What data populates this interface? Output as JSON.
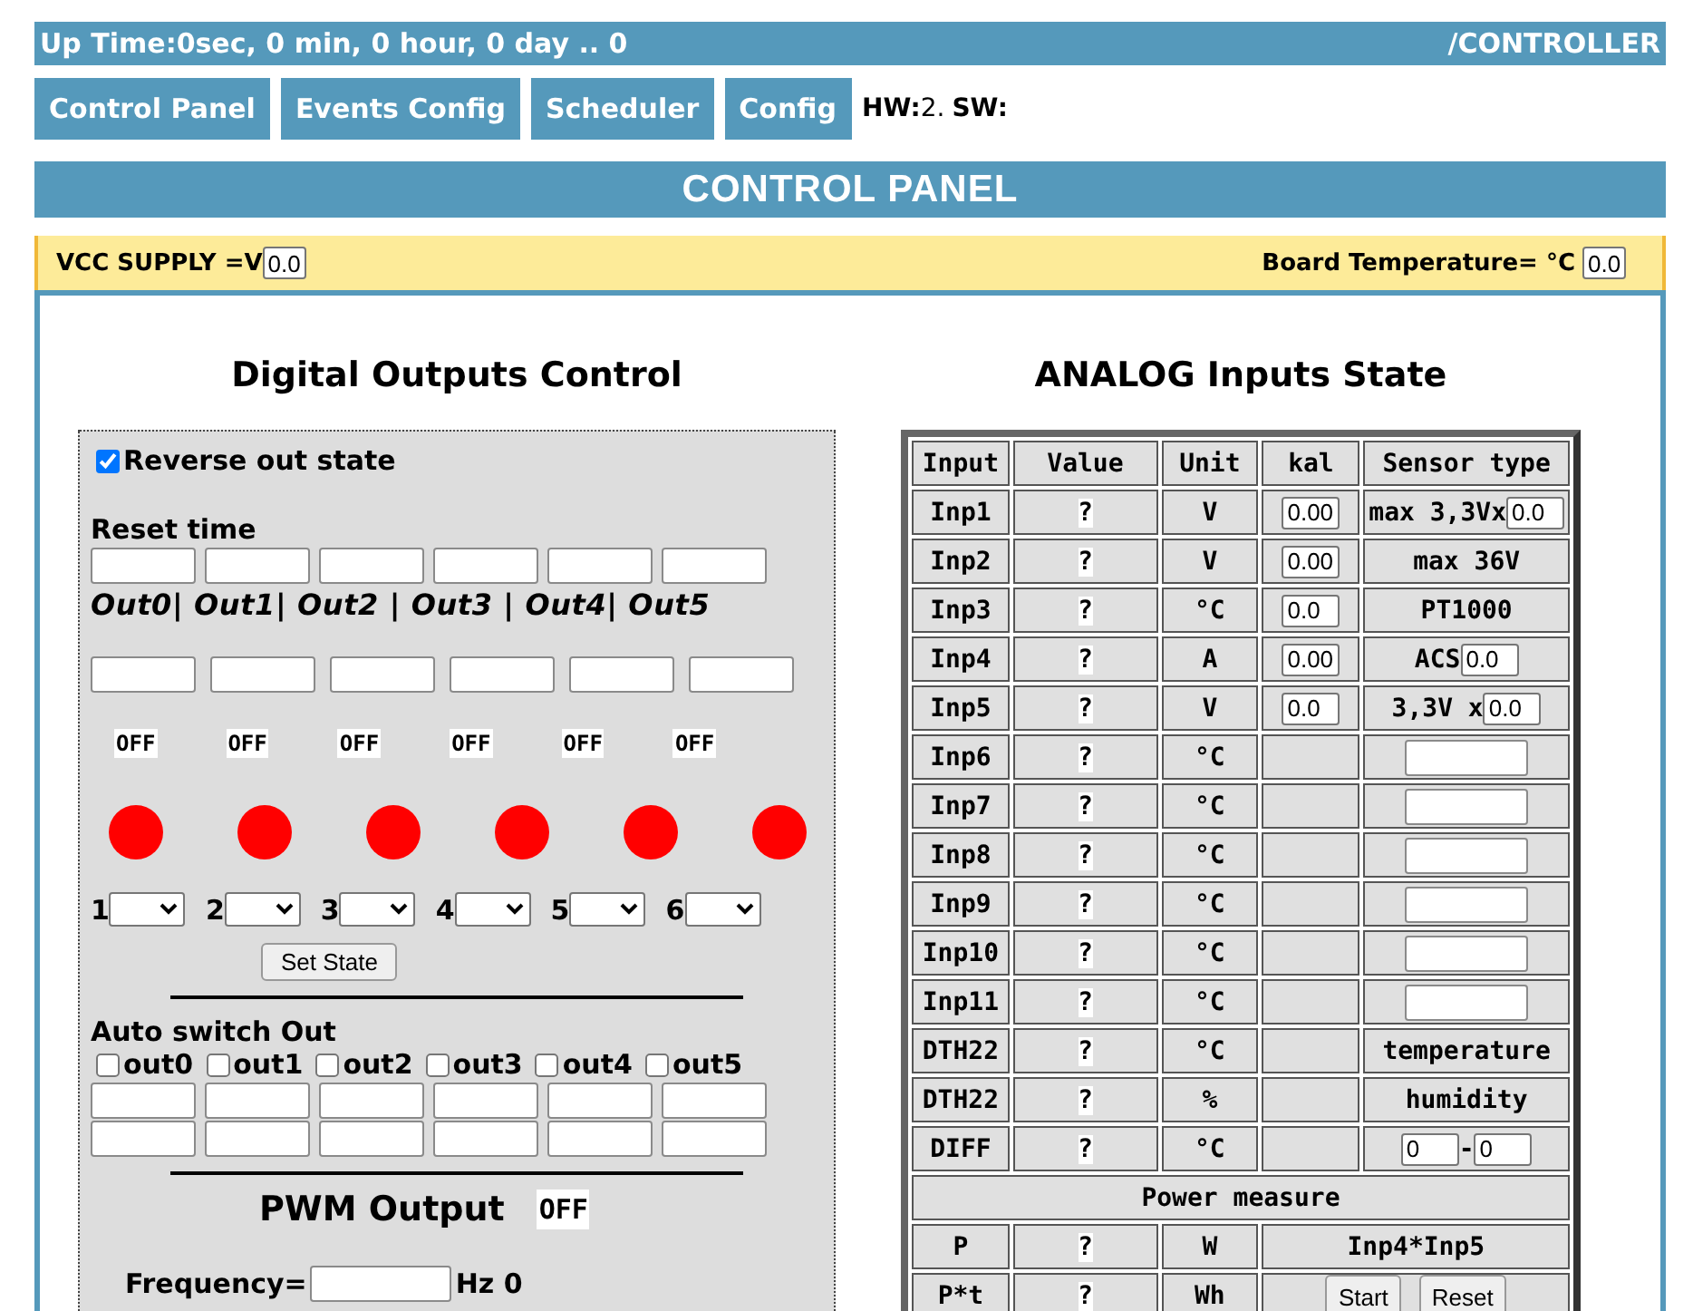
{
  "header": {
    "uptime": "Up Time:0sec, 0 min, 0 hour, 0 day .. 0",
    "path": "/CONTROLLER"
  },
  "nav": {
    "buttons": [
      "Control Panel",
      "Events Config",
      "Scheduler",
      "Config"
    ],
    "hw_label": "HW:",
    "hw_value": "2.",
    "sw_label": "SW:"
  },
  "title": "CONTROL PANEL",
  "supply": {
    "vcc_label": "VCC SUPPLY =V",
    "vcc_value": "0.0",
    "temp_label": "Board Temperature= °C",
    "temp_value": "0.0"
  },
  "digital": {
    "title": "Digital Outputs Control",
    "reverse": {
      "label": "Reverse out state",
      "checked": true
    },
    "reset_label": "Reset time",
    "out_labels": "Out0| Out1| Out2 | Out3 | Out4| Out5",
    "outputs": [
      {
        "state": "OFF",
        "on": false,
        "select_label": "1"
      },
      {
        "state": "OFF",
        "on": false,
        "select_label": "2"
      },
      {
        "state": "OFF",
        "on": false,
        "select_label": "3"
      },
      {
        "state": "OFF",
        "on": false,
        "select_label": "4"
      },
      {
        "state": "OFF",
        "on": false,
        "select_label": "5"
      },
      {
        "state": "OFF",
        "on": false,
        "select_label": "6"
      }
    ],
    "set_state": "Set State",
    "auto_label": "Auto switch Out",
    "auto": [
      {
        "label": "out0",
        "checked": false
      },
      {
        "label": "out1",
        "checked": false
      },
      {
        "label": "out2",
        "checked": false
      },
      {
        "label": "out3",
        "checked": false
      },
      {
        "label": "out4",
        "checked": false
      },
      {
        "label": "out5",
        "checked": false
      }
    ],
    "pwm": {
      "title": "PWM Output",
      "state": "OFF",
      "frequency_label": "Frequency=",
      "frequency_unit": "Hz 0"
    }
  },
  "analog": {
    "title": "ANALOG Inputs State",
    "columns": [
      "Input",
      "Value",
      "Unit",
      "kal",
      "Sensor type"
    ],
    "rows": [
      {
        "input": "Inp1",
        "value": "?",
        "unit": "V",
        "kal": "0.00",
        "sensor": {
          "kind": "text_input",
          "text": "max 3,3Vx",
          "value": "0.0"
        }
      },
      {
        "input": "Inp2",
        "value": "?",
        "unit": "V",
        "kal": "0.00",
        "sensor": {
          "kind": "text",
          "text": "max 36V"
        }
      },
      {
        "input": "Inp3",
        "value": "?",
        "unit": "°C",
        "kal": "0.0",
        "sensor": {
          "kind": "text",
          "text": "PT1000"
        }
      },
      {
        "input": "Inp4",
        "value": "?",
        "unit": "A",
        "kal": "0.00",
        "sensor": {
          "kind": "text_input",
          "text": "ACS",
          "value": "0.0"
        }
      },
      {
        "input": "Inp5",
        "value": "?",
        "unit": "V",
        "kal": "0.0",
        "sensor": {
          "kind": "text_input",
          "text": "3,3V x",
          "value": "0.0"
        }
      },
      {
        "input": "Inp6",
        "value": "?",
        "unit": "°C",
        "sensor": {
          "kind": "input"
        }
      },
      {
        "input": "Inp7",
        "value": "?",
        "unit": "°C",
        "sensor": {
          "kind": "input"
        }
      },
      {
        "input": "Inp8",
        "value": "?",
        "unit": "°C",
        "sensor": {
          "kind": "input"
        }
      },
      {
        "input": "Inp9",
        "value": "?",
        "unit": "°C",
        "sensor": {
          "kind": "input"
        }
      },
      {
        "input": "Inp10",
        "value": "?",
        "unit": "°C",
        "sensor": {
          "kind": "input"
        }
      },
      {
        "input": "Inp11",
        "value": "?",
        "unit": "°C",
        "sensor": {
          "kind": "input"
        }
      },
      {
        "input": "DTH22",
        "value": "?",
        "unit": "°C",
        "sensor": {
          "kind": "text",
          "text": "temperature"
        }
      },
      {
        "input": "DTH22",
        "value": "?",
        "unit": "%",
        "sensor": {
          "kind": "text",
          "text": "humidity"
        }
      },
      {
        "input": "DIFF",
        "value": "?",
        "unit": "°C",
        "sensor": {
          "kind": "range",
          "from": "0",
          "separator": "-",
          "to": "0"
        }
      }
    ],
    "power_title": "Power measure",
    "power_rows": [
      {
        "input": "P",
        "value": "?",
        "unit": "W",
        "kind": "text",
        "text": "Inp4*Inp5"
      },
      {
        "input": "P*t",
        "value": "?",
        "unit": "Wh",
        "kind": "buttons",
        "buttons": [
          "Start",
          "Reset"
        ]
      }
    ]
  }
}
